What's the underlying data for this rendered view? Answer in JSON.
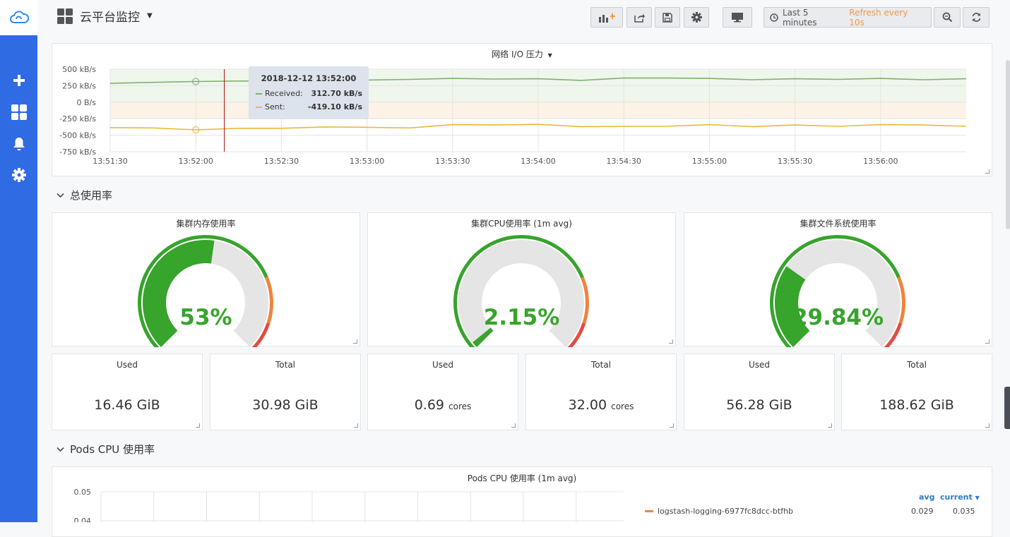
{
  "dashboard": {
    "title": "云平台监控"
  },
  "toolbar": {
    "time_range": "Last 5 minutes",
    "refresh": "Refresh every 10s"
  },
  "network_panel": {
    "title": "网络 I/O 压力",
    "tooltip": {
      "time": "2018-12-12 13:52:00",
      "rows": [
        {
          "label": "Received:",
          "value": "312.70 kB/s",
          "color": "#7eb26d"
        },
        {
          "label": "Sent:",
          "value": "-419.10 kB/s",
          "color": "#eab839"
        }
      ]
    }
  },
  "chart_data": [
    {
      "type": "line",
      "title": "网络 I/O 压力",
      "x": [
        "13:51:30",
        "13:51:45",
        "13:52:00",
        "13:52:15",
        "13:52:30",
        "13:52:45",
        "13:53:00",
        "13:53:15",
        "13:53:30",
        "13:53:45",
        "13:54:00",
        "13:54:15",
        "13:54:30",
        "13:54:45",
        "13:55:00",
        "13:55:15",
        "13:55:30",
        "13:55:45",
        "13:56:00",
        "13:56:15",
        "13:56:30"
      ],
      "x_ticks": [
        "13:51:30",
        "13:52:00",
        "13:52:30",
        "13:53:00",
        "13:53:30",
        "13:54:00",
        "13:54:30",
        "13:55:00",
        "13:55:30",
        "13:56:00"
      ],
      "y_ticks": [
        "500 kB/s",
        "250 kB/s",
        "0 B/s",
        "-250 kB/s",
        "-500 kB/s",
        "-750 kB/s"
      ],
      "ylim": [
        -750,
        500
      ],
      "y_unit": "kB/s",
      "series": [
        {
          "name": "Received",
          "color": "#7eb26d",
          "values": [
            285,
            300,
            312.7,
            320,
            316,
            330,
            335,
            345,
            360,
            350,
            355,
            330,
            365,
            365,
            360,
            340,
            355,
            345,
            360,
            340,
            355
          ]
        },
        {
          "name": "Sent",
          "color": "#eab839",
          "values": [
            -385,
            -390,
            -419.1,
            -395,
            -395,
            -375,
            -380,
            -390,
            -340,
            -345,
            -335,
            -370,
            -365,
            -365,
            -340,
            -370,
            -345,
            -365,
            -340,
            -345,
            -365
          ]
        }
      ],
      "threshold_bands": [
        {
          "from": 0,
          "to": 500,
          "color": "#eff6ec"
        },
        {
          "from": -250,
          "to": 0,
          "color": "#fcf2e6"
        }
      ],
      "cursor_time": "13:52:10",
      "grid": true
    },
    {
      "type": "line",
      "title": "Pods CPU 使用率 (1m avg)",
      "y_ticks": [
        "0.05",
        "0.04"
      ],
      "grid": true,
      "series": [
        {
          "name": "logstash-logging-6977fc8dcc-btfhb",
          "color": "#ef843c",
          "avg": "0.029",
          "current": "0.035"
        }
      ]
    }
  ],
  "row_total": {
    "title": "总使用率"
  },
  "gauges": [
    {
      "title": "集群内存使用率",
      "value": 53,
      "display": "53%"
    },
    {
      "title": "集群CPU使用率 (1m avg)",
      "value": 2.15,
      "display": "2.15%"
    },
    {
      "title": "集群文件系统使用率",
      "value": 29.84,
      "display": "29.84%"
    }
  ],
  "gauge_colors": {
    "ok": "#37a42c",
    "warn": "#ef843c",
    "crit": "#e24d42",
    "track": "#e5e5e5"
  },
  "stats": [
    {
      "label": "Used",
      "value": "16.46 GiB",
      "unit": ""
    },
    {
      "label": "Total",
      "value": "30.98 GiB",
      "unit": ""
    },
    {
      "label": "Used",
      "value": "0.69",
      "unit": "cores"
    },
    {
      "label": "Total",
      "value": "32.00",
      "unit": "cores"
    },
    {
      "label": "Used",
      "value": "56.28 GiB",
      "unit": ""
    },
    {
      "label": "Total",
      "value": "188.62 GiB",
      "unit": ""
    }
  ],
  "row_pods": {
    "title": "Pods CPU 使用率"
  },
  "pods_panel": {
    "title": "Pods CPU 使用率 (1m avg)",
    "legend_avg": "avg",
    "legend_current": "current",
    "legend_sort_icon": "caret-down-icon",
    "legend_items": [
      {
        "name": "logstash-logging-6977fc8dcc-btfhb",
        "avg": "0.029",
        "current": "0.035",
        "color": "#ef843c"
      }
    ]
  }
}
